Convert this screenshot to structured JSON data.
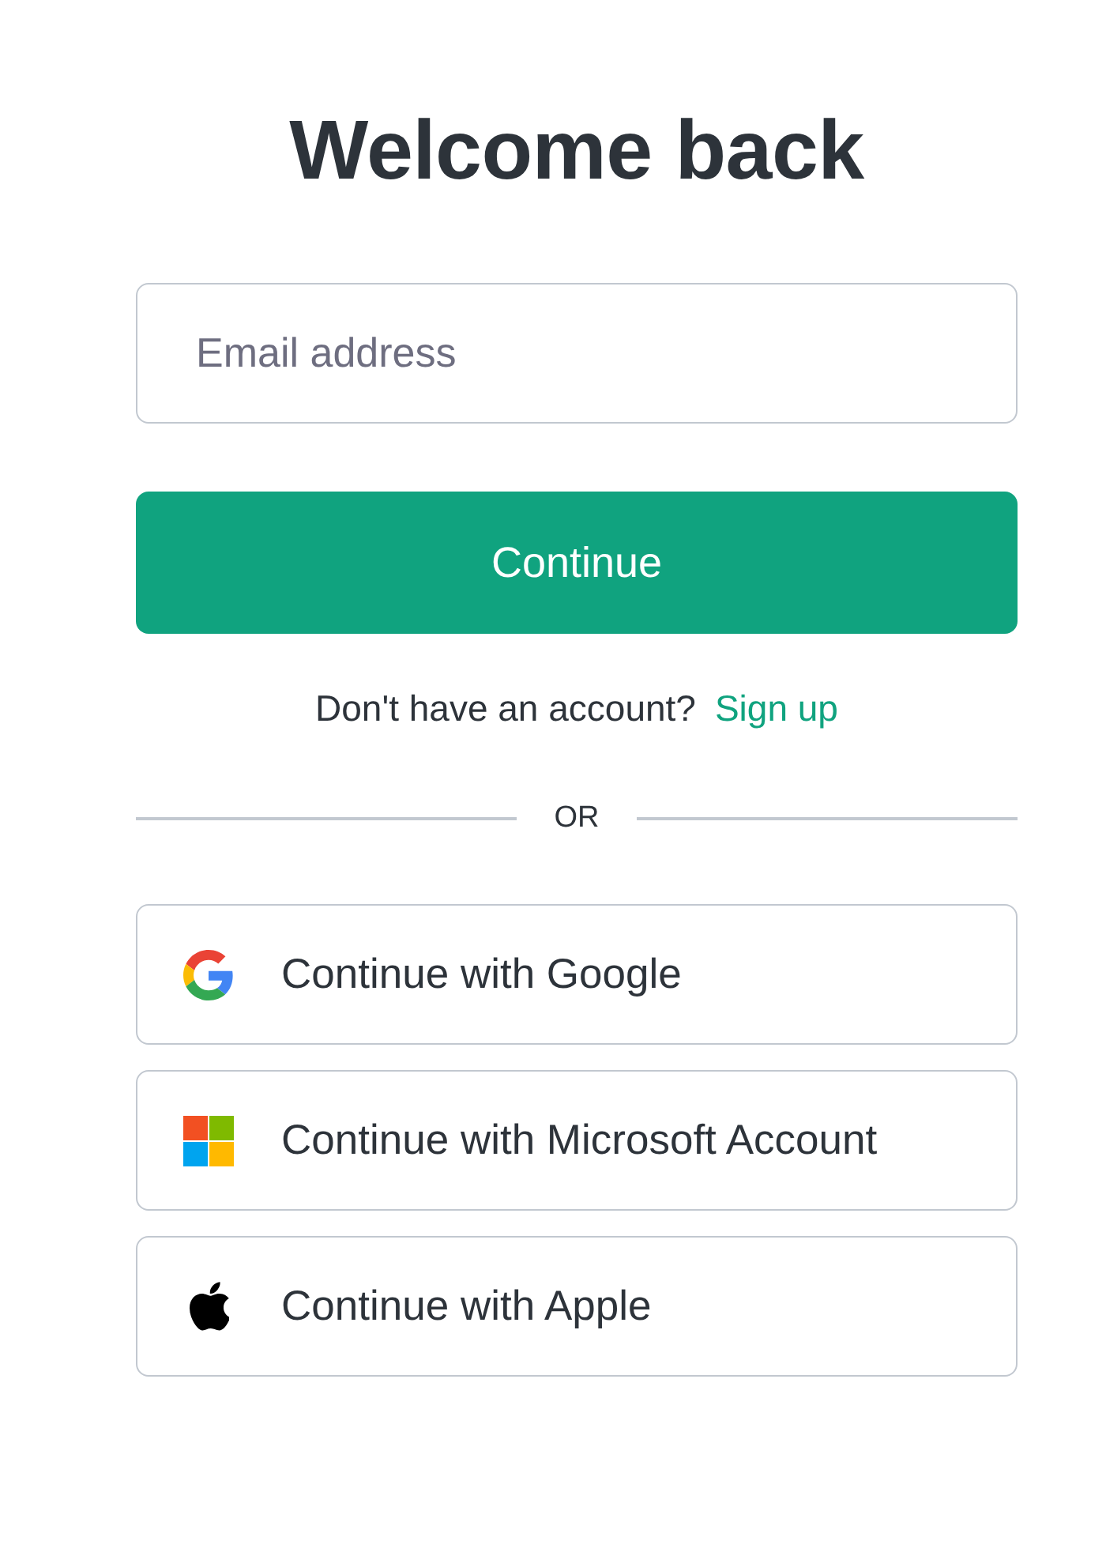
{
  "heading": "Welcome back",
  "email_field": {
    "placeholder": "Email address"
  },
  "continue_button": "Continue",
  "signup_prompt": {
    "text": "Don't have an account?",
    "link": "Sign up"
  },
  "divider": "OR",
  "social_buttons": [
    {
      "kind": "google",
      "label": "Continue with Google"
    },
    {
      "kind": "microsoft",
      "label": "Continue with Microsoft Account"
    },
    {
      "kind": "apple",
      "label": "Continue with Apple"
    }
  ]
}
